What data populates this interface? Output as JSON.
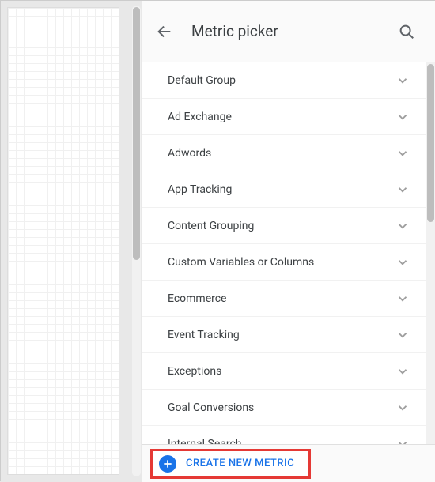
{
  "panel": {
    "title": "Metric picker"
  },
  "groups": {
    "items": [
      {
        "label": "Default Group"
      },
      {
        "label": "Ad Exchange"
      },
      {
        "label": "Adwords"
      },
      {
        "label": "App Tracking"
      },
      {
        "label": "Content Grouping"
      },
      {
        "label": "Custom Variables or Columns"
      },
      {
        "label": "Ecommerce"
      },
      {
        "label": "Event Tracking"
      },
      {
        "label": "Exceptions"
      },
      {
        "label": "Goal Conversions"
      },
      {
        "label": "Internal Search"
      }
    ]
  },
  "footer": {
    "create_label": "CREATE NEW METRIC"
  }
}
